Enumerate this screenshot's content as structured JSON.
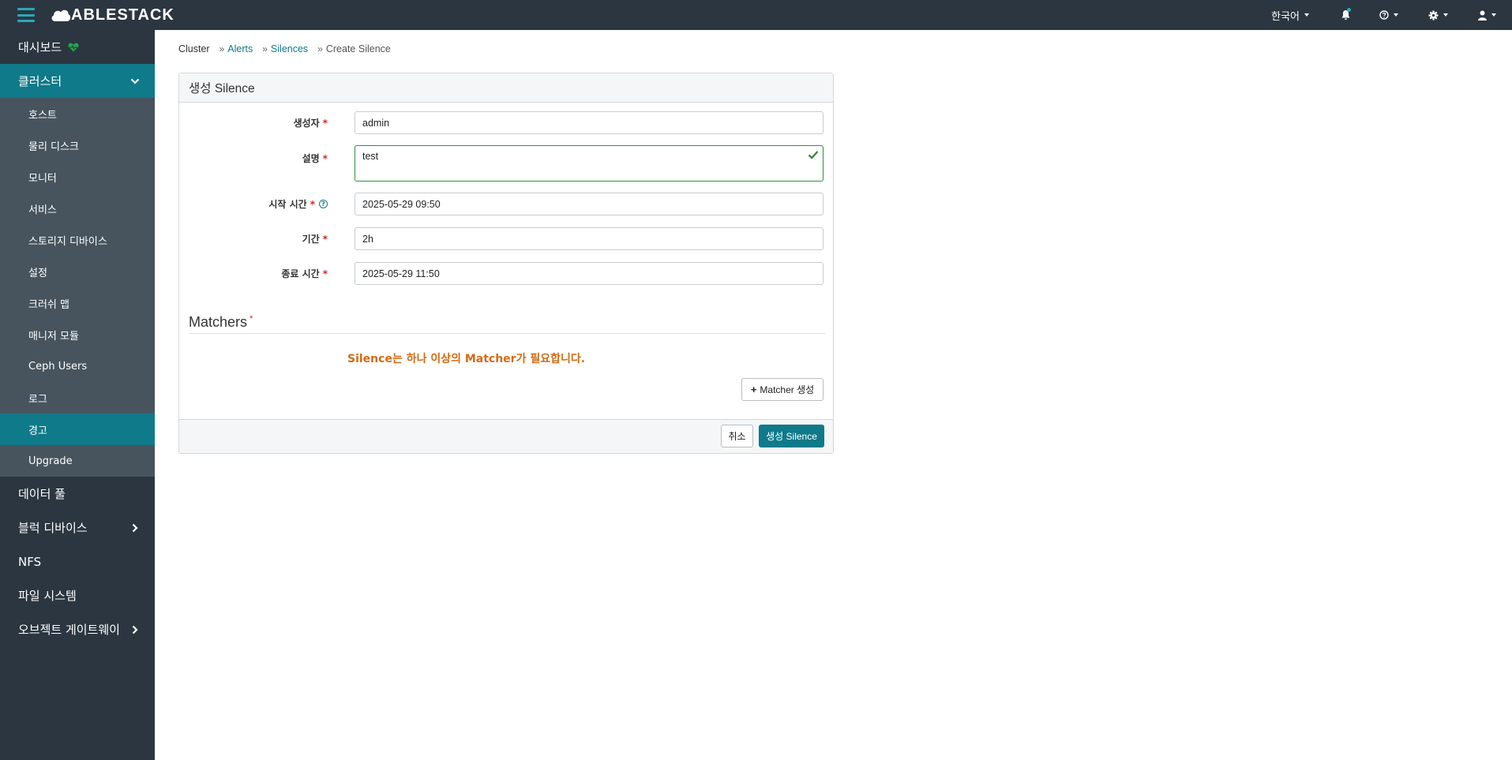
{
  "navbar": {
    "brand": "ABLESTACK",
    "language": "한국어"
  },
  "sidebar": {
    "dashboard": "대시보드",
    "cluster": "클러스터",
    "cluster_items": [
      "호스트",
      "물리 디스크",
      "모니터",
      "서비스",
      "스토리지 디바이스",
      "설정",
      "크러쉬 맵",
      "매니저 모듈",
      "Ceph Users",
      "로그",
      "경고",
      "Upgrade"
    ],
    "pools": "데이터 풀",
    "block": "블럭 디바이스",
    "nfs": "NFS",
    "filesystem": "파일 시스템",
    "object_gateway": "오브젝트 게이트웨이"
  },
  "breadcrumb": {
    "cluster": "Cluster",
    "alerts": "Alerts",
    "silences": "Silences",
    "current": "Create Silence"
  },
  "form": {
    "title": "생성 Silence",
    "creator_label": "생성자",
    "creator_value": "admin",
    "comment_label": "설명",
    "comment_value": "test",
    "start_label": "시작 시간",
    "start_value": "2025-05-29 09:50",
    "duration_label": "기간",
    "duration_value": "2h",
    "end_label": "종료 시간",
    "end_value": "2025-05-29 11:50",
    "matchers_title": "Matchers",
    "warning": "Silence는 하나 이상의 Matcher가 필요합니다.",
    "add_matcher": "Matcher 생성",
    "cancel": "취소",
    "submit": "생성 Silence",
    "required_mark": "*",
    "help_mark": "?"
  },
  "colors": {
    "navbar": "#2b3640",
    "accent": "#0f7a8a",
    "sub_menu": "#47545e",
    "warning": "#d26b14",
    "valid": "#2f8f3a"
  }
}
